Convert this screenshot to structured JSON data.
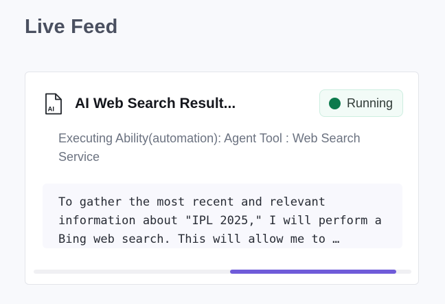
{
  "header": {
    "title": "Live Feed"
  },
  "card": {
    "icon": "ai-file-icon",
    "icon_label": "AI",
    "title": "AI Web Search Result...",
    "status": {
      "label": "Running",
      "color": "#0d7a4d"
    },
    "description": "Executing Ability(automation): Agent Tool : Web Search Service",
    "log": "To gather the most recent and relevant information about \"IPL 2025,\" I will perform a Bing web search. This will allow me to …",
    "progress": {
      "fill_start": 0.52,
      "fill_end": 0.96,
      "color": "#6f5bd9"
    }
  }
}
